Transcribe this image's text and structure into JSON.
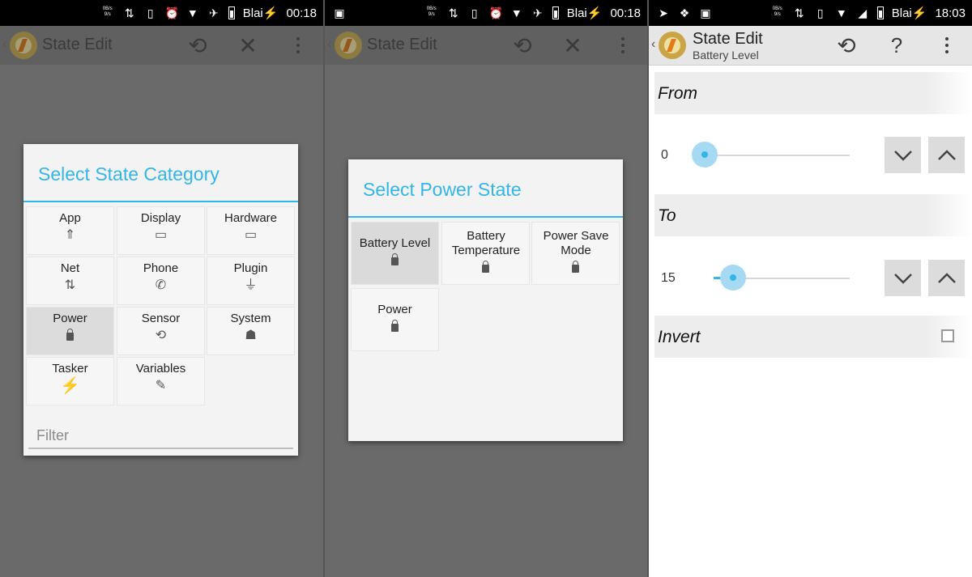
{
  "panel1": {
    "status": {
      "time": "00:18",
      "carrier": "Blai",
      "tiny": "0B/s\n9/s"
    },
    "actionbar": {
      "title": "State Edit"
    },
    "dialog": {
      "title": "Select State Category",
      "items": [
        {
          "label": "App",
          "icon": "rocket-icon",
          "glyph": "🚀"
        },
        {
          "label": "Display",
          "icon": "monitor-icon",
          "glyph": "▭"
        },
        {
          "label": "Hardware",
          "icon": "laptop-icon",
          "glyph": "⌂"
        },
        {
          "label": "Net",
          "icon": "data-arrows-icon",
          "glyph": "⇅"
        },
        {
          "label": "Phone",
          "icon": "phone-icon",
          "glyph": "✆"
        },
        {
          "label": "Plugin",
          "icon": "plug-icon",
          "glyph": "⏚"
        },
        {
          "label": "Power",
          "icon": "battery-icon",
          "glyph": ""
        },
        {
          "label": "Sensor",
          "icon": "rotate-icon",
          "glyph": "⟲"
        },
        {
          "label": "System",
          "icon": "android-icon",
          "glyph": "☗"
        },
        {
          "label": "Tasker",
          "icon": "bolt-icon",
          "glyph": "⚡"
        },
        {
          "label": "Variables",
          "icon": "tag-icon",
          "glyph": "✎"
        }
      ],
      "filter_placeholder": "Filter"
    }
  },
  "panel2": {
    "status": {
      "time": "00:18",
      "carrier": "Blai",
      "tiny": "0B/s\n9/s"
    },
    "actionbar": {
      "title": "State Edit"
    },
    "dialog": {
      "title": "Select Power State",
      "items": [
        {
          "label": "Battery Level",
          "icon": "battery-icon"
        },
        {
          "label": "Battery Temperature",
          "icon": "battery-icon"
        },
        {
          "label": "Power Save Mode",
          "icon": "battery-icon"
        },
        {
          "label": "Power",
          "icon": "battery-icon"
        }
      ]
    }
  },
  "panel3": {
    "status": {
      "time": "18:03",
      "carrier": "Blai",
      "tiny": "0B/s\n9/s"
    },
    "actionbar": {
      "title": "State Edit",
      "subtitle": "Battery Level"
    },
    "from": {
      "label": "From",
      "value": "0",
      "level": 0
    },
    "to": {
      "label": "To",
      "value": "15",
      "level": 15
    },
    "invert": {
      "label": "Invert",
      "checked": false
    }
  },
  "colors": {
    "accent": "#33b5e5",
    "dim_bg": "#6a6a6a"
  }
}
